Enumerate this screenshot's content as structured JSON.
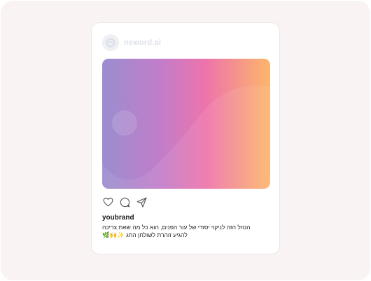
{
  "post": {
    "brand_name": "neword.ai",
    "username": "youbrand",
    "caption_line1": "הנוזל הזה לניקוי יסודי של עור הפנים, הוא כל מה שאת צריכה",
    "caption_line2": "להגיע זוהרת לשולחן החג ✨🙌🌿"
  },
  "icons": {
    "avatar": "brand-logo-icon",
    "like": "heart-icon",
    "comment": "comment-bubble-icon",
    "share": "paper-plane-icon"
  },
  "colors": {
    "background": "#f9f3f3",
    "card": "#ffffff",
    "gradient": [
      "#9a8ed0",
      "#c27dc9",
      "#ee74ab",
      "#fdb66a"
    ]
  }
}
